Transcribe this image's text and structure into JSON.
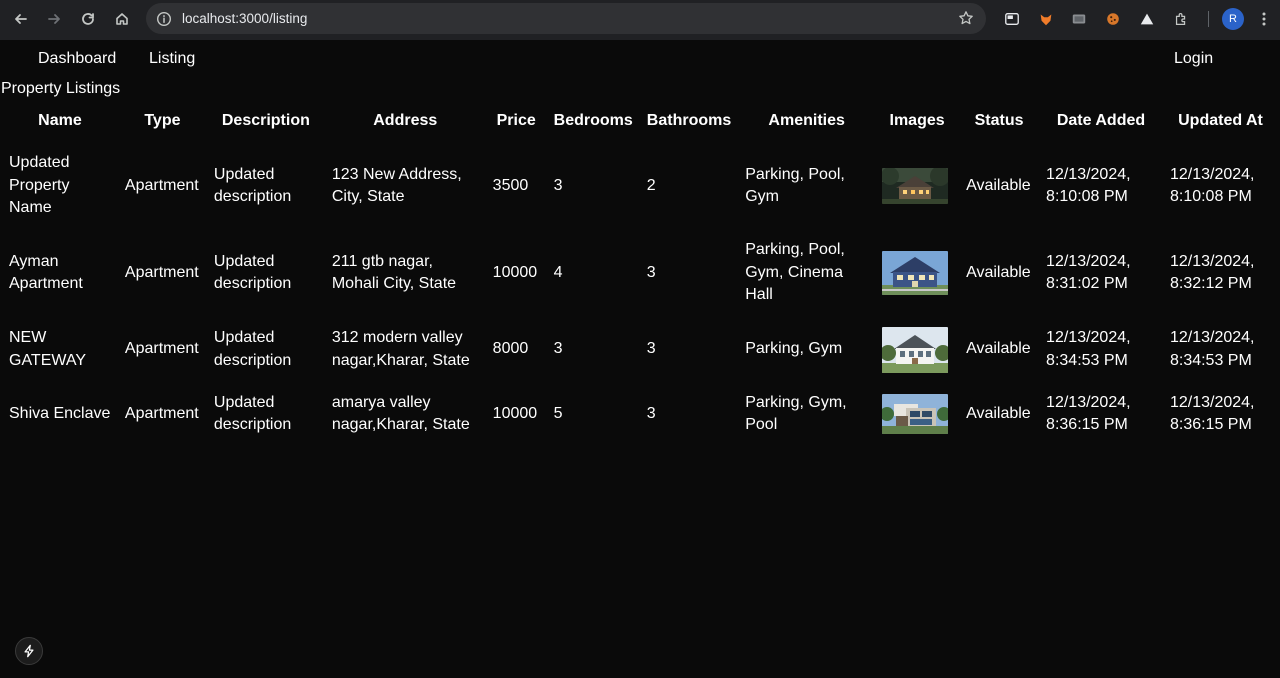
{
  "browser": {
    "url": "localhost:3000/listing",
    "profile_initial": "R"
  },
  "nav": {
    "dashboard": "Dashboard",
    "listing": "Listing",
    "login": "Login"
  },
  "page_title": "Property Listings",
  "table": {
    "headers": [
      "Name",
      "Type",
      "Description",
      "Address",
      "Price",
      "Bedrooms",
      "Bathrooms",
      "Amenities",
      "Images",
      "Status",
      "Date Added",
      "Updated At"
    ],
    "rows": [
      {
        "name": "Updated Property Name",
        "type": "Apartment",
        "description": "Updated description",
        "address": "123 New Address, City, State",
        "price": "3500",
        "bedrooms": "3",
        "bathrooms": "2",
        "amenities": "Parking, Pool, Gym",
        "image": "house-night-photo",
        "status": "Available",
        "date_added": "12/13/2024, 8:10:08 PM",
        "updated_at": "12/13/2024, 8:10:08 PM"
      },
      {
        "name": "Ayman Apartment",
        "type": "Apartment",
        "description": "Updated description",
        "address": "211 gtb nagar, Mohali City, State",
        "price": "10000",
        "bedrooms": "4",
        "bathrooms": "3",
        "amenities": "Parking, Pool, Gym, Cinema Hall",
        "image": "blue-house-photo",
        "status": "Available",
        "date_added": "12/13/2024, 8:31:02 PM",
        "updated_at": "12/13/2024, 8:32:12 PM"
      },
      {
        "name": "NEW GATEWAY",
        "type": "Apartment",
        "description": "Updated description",
        "address": "312 modern valley nagar,Kharar, State",
        "price": "8000",
        "bedrooms": "3",
        "bathrooms": "3",
        "amenities": "Parking, Gym",
        "image": "white-house-photo",
        "status": "Available",
        "date_added": "12/13/2024, 8:34:53 PM",
        "updated_at": "12/13/2024, 8:34:53 PM"
      },
      {
        "name": "Shiva Enclave",
        "type": "Apartment",
        "description": "Updated description",
        "address": "amarya valley nagar,Kharar, State",
        "price": "10000",
        "bedrooms": "5",
        "bathrooms": "3",
        "amenities": "Parking, Gym, Pool",
        "image": "modern-house-photo",
        "status": "Available",
        "date_added": "12/13/2024, 8:36:15 PM",
        "updated_at": "12/13/2024, 8:36:15 PM"
      }
    ]
  }
}
